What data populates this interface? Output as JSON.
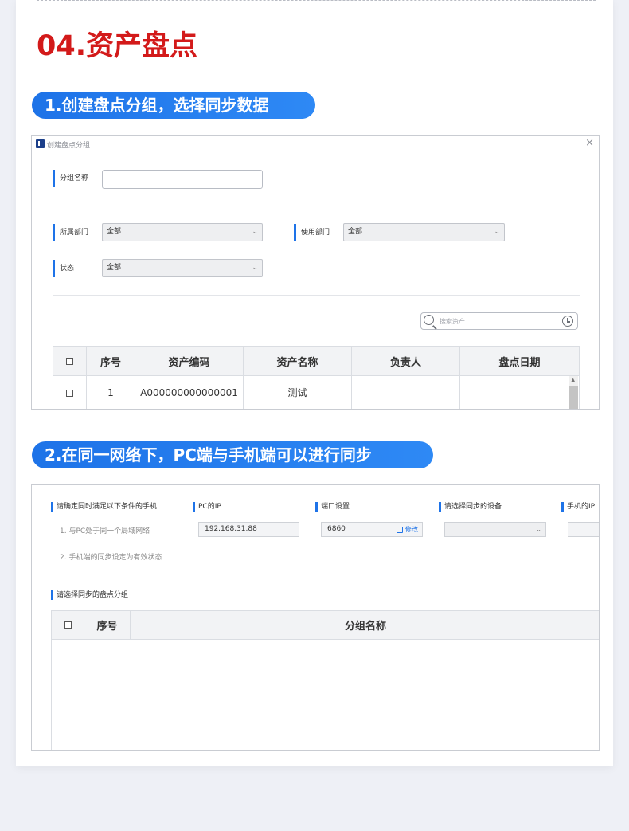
{
  "section": {
    "title": "04.资产盘点"
  },
  "step1": {
    "pill": "1.创建盘点分组，选择同步数据",
    "window_title": "创建盘点分组",
    "close": "×",
    "group_name_label": "分组名称",
    "group_name_value": "",
    "dept_label": "所属部门",
    "dept_value": "全部",
    "use_dept_label": "使用部门",
    "use_dept_value": "全部",
    "status_label": "状态",
    "status_value": "全部",
    "search_placeholder": "搜索资产...",
    "table": {
      "headers": [
        "序号",
        "资产编码",
        "资产名称",
        "负责人",
        "盘点日期"
      ],
      "rows": [
        {
          "no": "1",
          "code": "A000000000000001",
          "name": "测试",
          "owner": "",
          "date": ""
        }
      ]
    }
  },
  "step2": {
    "pill": "2.在同一网络下，PC端与手机端可以进行同步",
    "cond_label": "请确定同时满足以下条件的手机",
    "cond1": "1. 与PC处于同一个局域网络",
    "cond2": "2. 手机端的同步设定为有效状态",
    "pc_ip_label": "PC的IP",
    "pc_ip_value": "192.168.31.88",
    "port_label": "端口设置",
    "port_value": "6860",
    "edit_label": "修改",
    "device_label": "请选择同步的设备",
    "device_value": "",
    "phone_ip_label": "手机的IP",
    "group_select_label": "请选择同步的盘点分组",
    "table": {
      "headers": [
        "序号",
        "分组名称"
      ]
    }
  },
  "colors": {
    "accent": "#1e73e8",
    "title_red": "#d31a1a"
  }
}
